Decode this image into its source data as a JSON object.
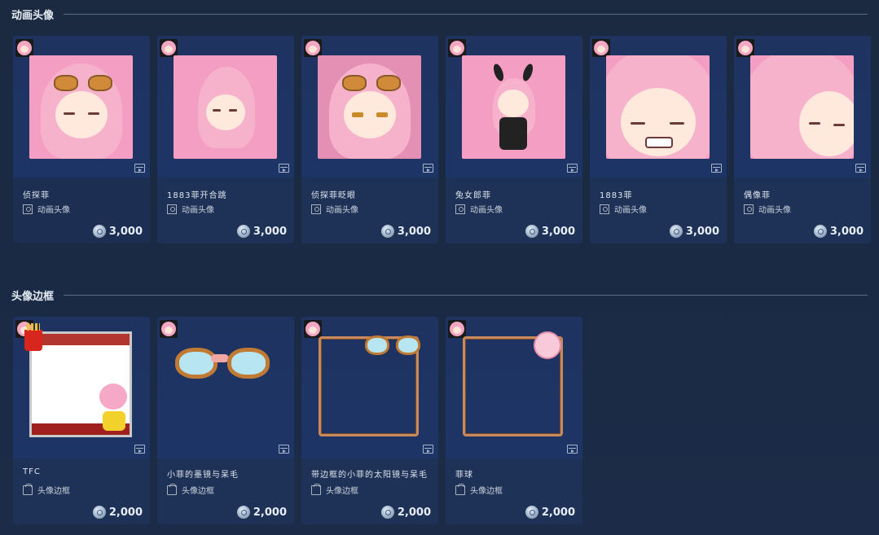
{
  "sections": [
    {
      "title": "动画头像",
      "items": [
        {
          "name": "侦探菲",
          "type": "动画头像",
          "price": "3,000"
        },
        {
          "name": "1883菲开合跳",
          "type": "动画头像",
          "price": "3,000"
        },
        {
          "name": "侦探菲眨眼",
          "type": "动画头像",
          "price": "3,000"
        },
        {
          "name": "兔女郎菲",
          "type": "动画头像",
          "price": "3,000"
        },
        {
          "name": "1883菲",
          "type": "动画头像",
          "price": "3,000"
        },
        {
          "name": "偶像菲",
          "type": "动画头像",
          "price": "3,000"
        }
      ]
    },
    {
      "title": "头像边框",
      "items": [
        {
          "name": "TFC",
          "type": "头像边框",
          "price": "2,000"
        },
        {
          "name": "小菲的墨镜与呆毛",
          "type": "头像边框",
          "price": "2,000"
        },
        {
          "name": "带边框的小菲的太阳镜与呆毛",
          "type": "头像边框",
          "price": "2,000"
        },
        {
          "name": "菲球",
          "type": "头像边框",
          "price": "2,000"
        }
      ]
    }
  ],
  "icons": {
    "coin": "steam-points-coin-icon",
    "animated": "video-icon",
    "portrait": "portrait-icon",
    "frame": "frame-icon"
  },
  "colors": {
    "background": "#1b2a40",
    "card": "#1e3156",
    "pink": "#f49ec3"
  }
}
